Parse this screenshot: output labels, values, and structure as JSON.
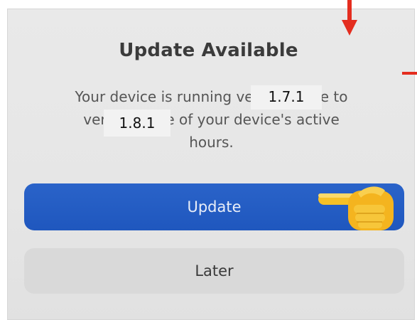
{
  "dialog": {
    "title": "Update Available",
    "message_line1": "Your device is running versio     Jpdate to",
    "message_line2": "version       tside of your device's active",
    "message_line3": "hours.",
    "current_version": "1.7.1",
    "new_version": "1.8.1"
  },
  "buttons": {
    "update_label": "Update",
    "later_label": "Later"
  },
  "colors": {
    "update_button": "#1f57be",
    "later_button": "#d9d9d9",
    "annotation_red": "#e42d1f"
  },
  "icons": {
    "pointer": "pointing-hand-icon",
    "annotation_arrow": "red-arrow-down-icon"
  }
}
